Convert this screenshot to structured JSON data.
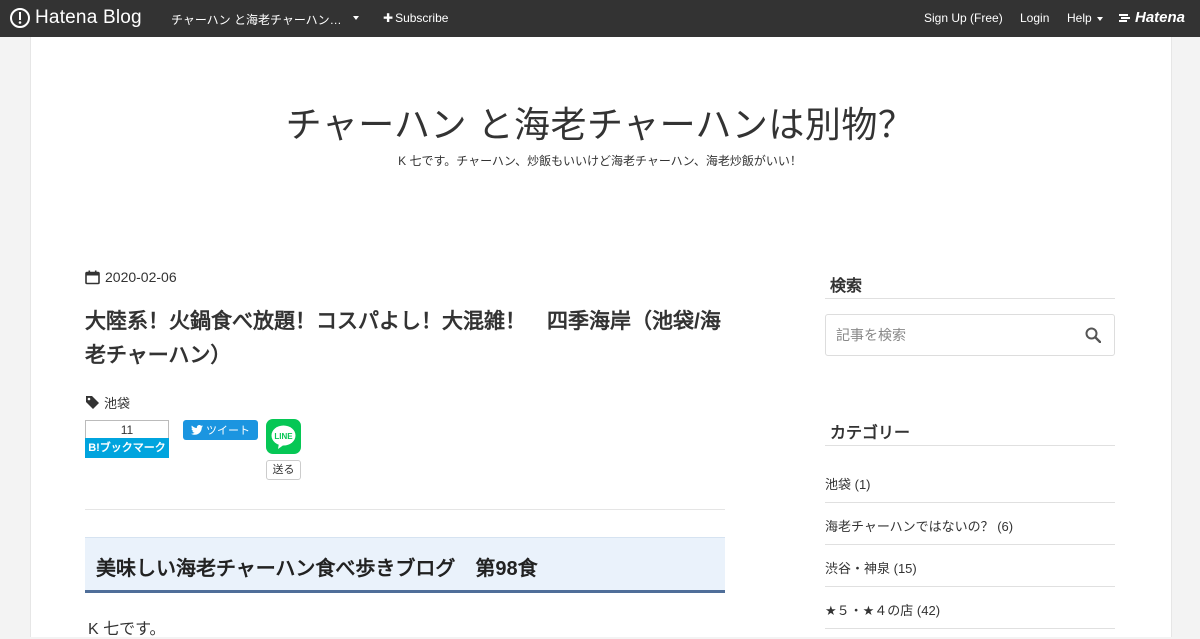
{
  "topbar": {
    "logo_text": "Hatena Blog",
    "blog_title": "チャーハン と海老チャーハン…",
    "subscribe_label": "Subscribe",
    "signup_label": "Sign Up (Free)",
    "login_label": "Login",
    "help_label": "Help",
    "hatena_label": "Hatena"
  },
  "header": {
    "title": "チャーハン と海老チャーハンは別物？",
    "description": "K 七です。チャーハン、炒飯もいいけど海老チャーハン、海老炒飯がいい！"
  },
  "article": {
    "date": "2020-02-06",
    "title": "大陸系！火鍋食べ放題！コスパよし！大混雑！　四季海岸（池袋/海老チャーハン）",
    "category": "池袋",
    "bookmark_count": "11",
    "bookmark_label": "B!ブックマーク",
    "tweet_label": "ツイート",
    "line_label": "LINE",
    "line_send_label": "送る",
    "section_heading": "美味しい海老チャーハン食べ歩きブログ　第98食",
    "first_paragraph": "K 七です。"
  },
  "sidebar": {
    "search_heading": "検索",
    "search_placeholder": "記事を検索",
    "category_heading": "カテゴリー",
    "categories": [
      {
        "label": "池袋 (1)"
      },
      {
        "label": "海老チャーハンではないの？ (6)"
      },
      {
        "label": "渋谷・神泉 (15)"
      },
      {
        "label": "★５・★４の店 (42)"
      }
    ]
  },
  "colors": {
    "topbar_bg": "#333333",
    "hatena_bookmark": "#00a4de",
    "twitter": "#1b95e0",
    "line": "#06c755",
    "heading_accent": "#4f6e99"
  }
}
